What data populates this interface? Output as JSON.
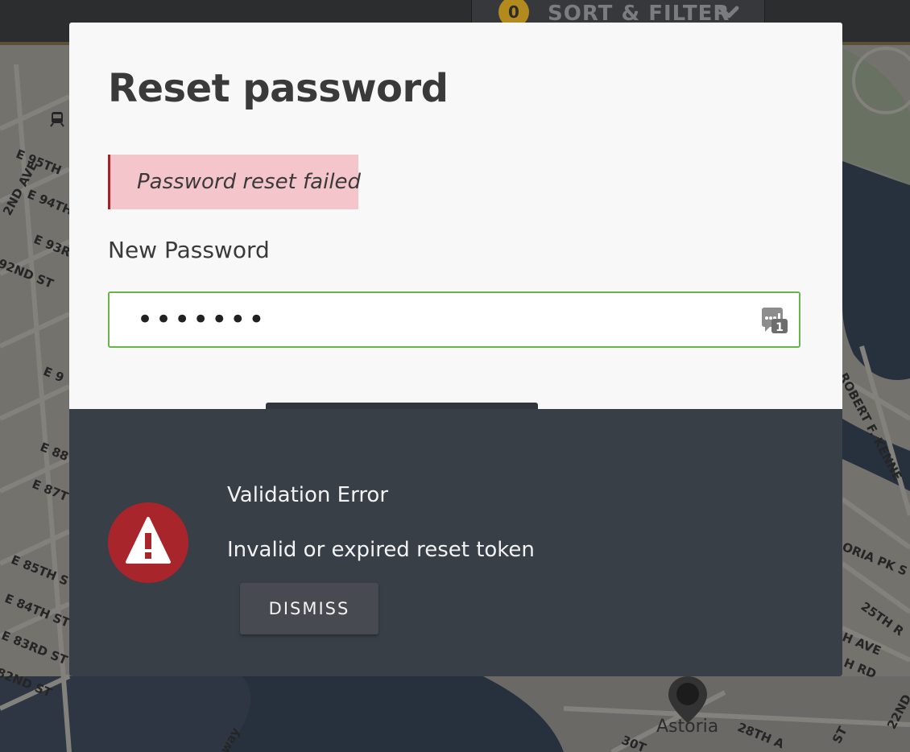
{
  "topbar": {
    "filter_count": "0",
    "filter_label": "SORT & FILTER",
    "chevron_icon": "chevron-down-icon"
  },
  "map": {
    "street_labels": [
      "E 95TH",
      "2ND AVE",
      "E 94TH",
      "E 93R",
      "92ND ST",
      "E 9",
      "E 88",
      "E 87T",
      "E 85TH S",
      "E 84TH ST",
      "E 83RD ST",
      "82ND ST",
      "ROBERT F. KENNE",
      "ORIA PK S",
      "25TH R",
      "H AVE",
      "H RD",
      "Astoria",
      "28TH A",
      "30T",
      "ST",
      "22ND",
      "way"
    ],
    "pin_icon": "map-pin-icon",
    "transit_icon": "train-icon"
  },
  "modal": {
    "title": "Reset password",
    "alert_text": "Password reset failed",
    "field_label": "New Password",
    "password_value": "•••••••",
    "password_manager_icon": "password-manager-icon"
  },
  "error": {
    "icon": "warning-icon",
    "title": "Validation Error",
    "message": "Invalid or expired reset token",
    "dismiss_label": "DISMISS"
  },
  "colors": {
    "alert_bg": "#f4c5cb",
    "alert_border": "#a72127",
    "input_border": "#69b34c",
    "error_panel_bg": "#393f47",
    "warning_red": "#a8262b",
    "filter_badge": "#b28a1e"
  }
}
